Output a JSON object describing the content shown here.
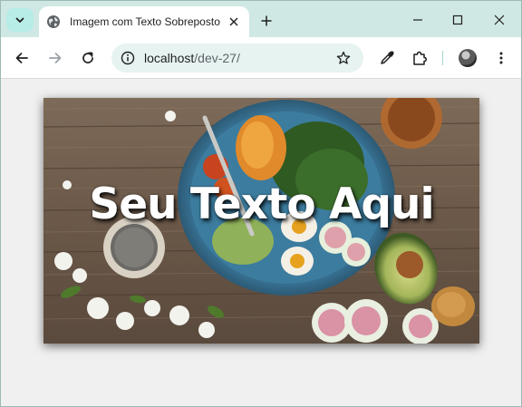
{
  "browser": {
    "tab": {
      "title": "Imagem com Texto Sobreposto",
      "favicon": "globe-icon"
    },
    "address": {
      "host": "localhost",
      "path": "/dev-27/"
    },
    "controls": {
      "tab_search": "chevron-down-icon",
      "close_tab": "close-icon",
      "new_tab": "plus-icon",
      "minimize": "minimize-icon",
      "maximize": "maximize-icon",
      "close_window": "close-icon",
      "back": "arrow-left-icon",
      "forward": "arrow-right-icon",
      "reload": "reload-icon",
      "site_info": "site-info-icon",
      "bookmark": "star-icon",
      "eyedropper": "eyedropper-icon",
      "extensions": "puzzle-icon",
      "menu": "more-vert-icon"
    }
  },
  "page": {
    "overlay_text": "Seu Texto Aqui",
    "image_subject": "food-photo"
  },
  "colors": {
    "tabstrip": "#cfe8e4",
    "omnibox": "#e6f3f1",
    "page_background": "#f0f0f0",
    "overlay_text": "#ffffff"
  }
}
